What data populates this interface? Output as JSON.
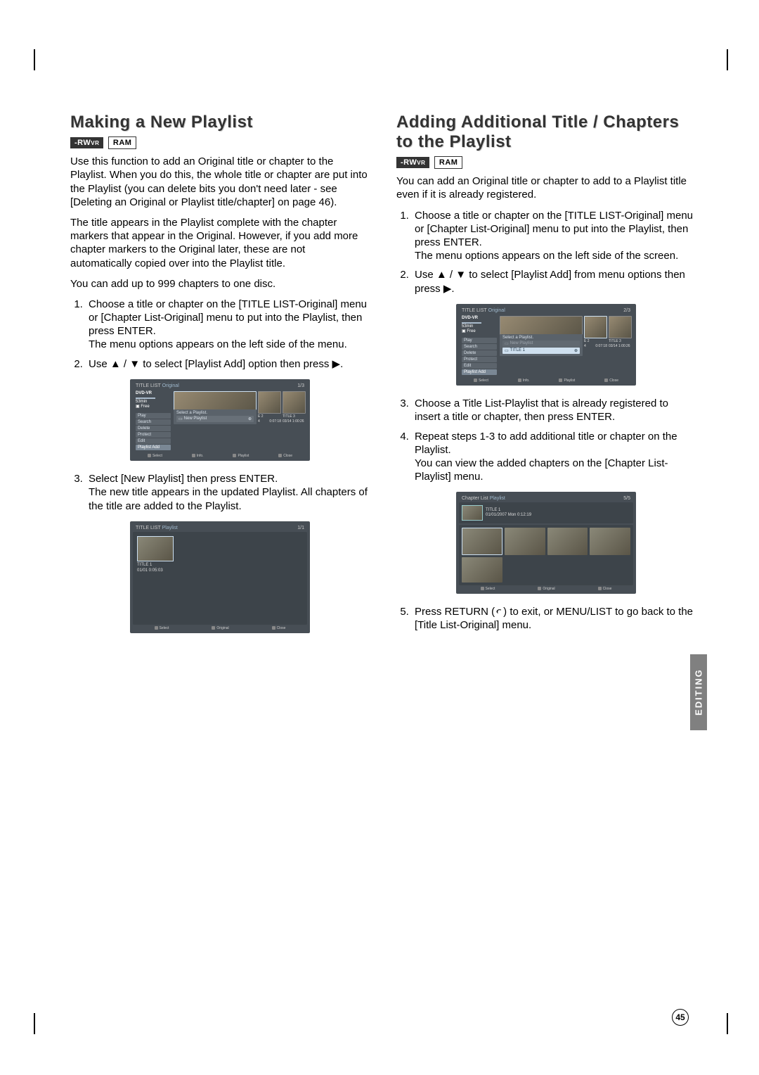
{
  "page_number": "45",
  "side_tab": "EDITING",
  "left": {
    "heading": "Making a New Playlist",
    "badges": {
      "rw": "-RW",
      "rw_sub": "VR",
      "ram": "RAM"
    },
    "p1": "Use this function to add an Original title or chapter to the Playlist. When you do this, the whole title or chapter are put into the Playlist (you can delete bits you don't need later - see [Deleting an Original or Playlist title/chapter] on page 46).",
    "p2": "The title appears in the Playlist complete with the chapter markers that appear in the Original. However, if you add more chapter markers to the Original later, these are not automatically copied over into the Playlist title.",
    "p3": "You can add up to 999 chapters to one disc.",
    "step1": "Choose a title or chapter on the [TITLE LIST-Original] menu or [Chapter List-Original] menu to put into the Playlist, then press ENTER.\nThe menu options appears on the left side of the menu.",
    "step2a": "Use ",
    "step2b": " to select [Playlist Add] option then press ",
    "step3": "Select [New Playlist] then press ENTER.\nThe new title appears in the updated Playlist. All chapters of the title are added to the Playlist.",
    "shot1": {
      "header_l": "TITLE LIST",
      "header_m": "Original",
      "header_r": "1/3",
      "disc": "DVD-VR",
      "time": "53min",
      "free": "Free",
      "menu": [
        "Play",
        "Search",
        "Delete",
        "Protect",
        "Edit",
        "Playlist Add"
      ],
      "popup_head": "Select a Playlist.",
      "popup_opt1": "New Playlist",
      "popup_opt1_icon": "⊕",
      "t2": "E 2",
      "t2d": "0:07:18",
      "t3": "TITLE 3",
      "t3d": "03/14   1:00:26",
      "footer": [
        "Select",
        "Info.",
        "Playlist",
        "Close"
      ]
    },
    "shot2": {
      "header_l": "TITLE LIST",
      "header_m": "Playlist",
      "header_r": "1/1",
      "t1": "TITLE 1",
      "t1d": "01/01      0:05:03",
      "footer": [
        "Select",
        "Original",
        "Close"
      ]
    }
  },
  "right": {
    "heading": "Adding Additional Title / Chapters to the Playlist",
    "badges": {
      "rw": "-RW",
      "rw_sub": "VR",
      "ram": "RAM"
    },
    "p1": "You can add an Original title or chapter to add to a Playlist title even if it is already registered.",
    "step1": "Choose a title or chapter on the [TITLE LIST-Original] menu or [Chapter List-Original] menu to put into the Playlist, then press ENTER.\nThe menu options appears on the left side of the screen.",
    "step2a": "Use ",
    "step2b": " to select [Playlist Add] from menu options then press ",
    "step3": "Choose a Title List-Playlist that is already registered to insert a title or chapter, then press ENTER.",
    "step4": "Repeat steps 1-3 to add additional title or chapter on the Playlist.\nYou can view the added chapters on the [Chapter List-Playlist] menu.",
    "step5a": "Press RETURN (",
    "step5b": ") to exit, or MENU/LIST to go back to the [Title List-Original] menu.",
    "shot1": {
      "header_l": "TITLE LIST",
      "header_m": "Original",
      "header_r": "2/3",
      "disc": "DVD-VR",
      "time": "53min",
      "free": "Free",
      "menu": [
        "Play",
        "Search",
        "Delete",
        "Protect",
        "Edit",
        "Playlist Add"
      ],
      "popup_head": "Select a Playlist.",
      "popup_opt1": "New Playlist",
      "popup_opt2": "TITLE 1",
      "t2": "E 2",
      "t2d": "0:07:18",
      "t3": "TITLE 3",
      "t3d": "03/14   1:00:26",
      "footer": [
        "Select",
        "Info.",
        "Playlist",
        "Close"
      ]
    },
    "shot2": {
      "header_l": "Chapter List",
      "header_m": "Playlist",
      "header_r": "5/5",
      "t1": "TITLE 1",
      "t1d": "01/01/2007  Mon    0:12:19",
      "footer": [
        "Select",
        "Original",
        "Close"
      ]
    }
  }
}
